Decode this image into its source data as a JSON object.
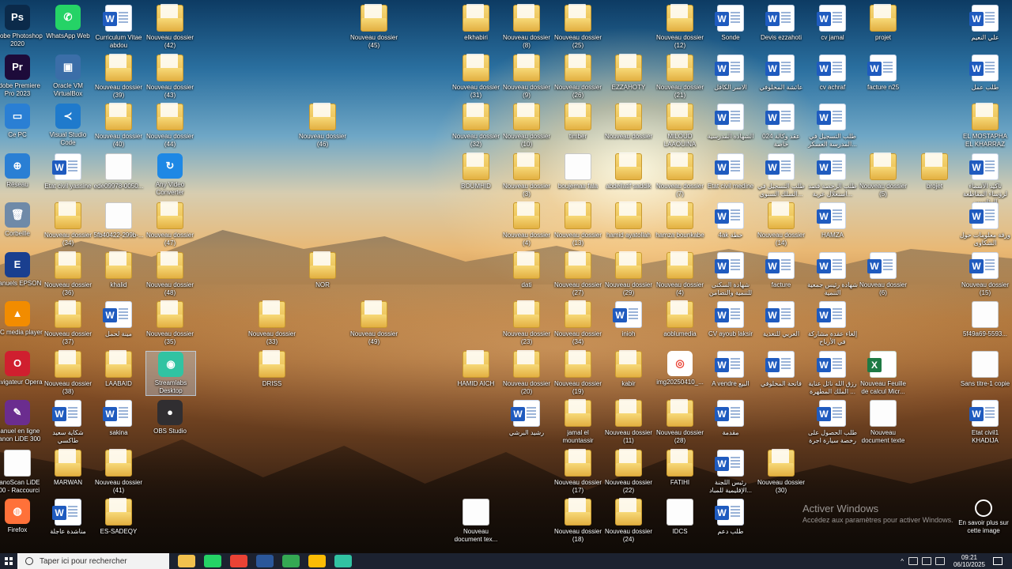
{
  "desktop": {
    "icons": [
      {
        "label": "Adobe Photoshop 2020",
        "type": "app",
        "abbr": "Ps",
        "color": "#0b2a4a"
      },
      {
        "label": "WhatsApp Web",
        "type": "app",
        "abbr": "✆",
        "color": "#25d366"
      },
      {
        "label": "Curriculum Vitae abdou",
        "type": "word"
      },
      {
        "label": "Nouveau dossier (42)",
        "type": "folder"
      },
      {
        "label": "Nouveau dossier (45)",
        "type": "folder"
      },
      {
        "label": "elkhabiri",
        "type": "folder"
      },
      {
        "label": "Nouveau dossier (8)",
        "type": "folder"
      },
      {
        "label": "Nouveau dossier (25)",
        "type": "folder"
      },
      {
        "label": "Nouveau dossier (12)",
        "type": "folder"
      },
      {
        "label": "Sonde",
        "type": "word"
      },
      {
        "label": "Devis ezzahoti",
        "type": "word"
      },
      {
        "label": "cv jamal",
        "type": "word"
      },
      {
        "label": "projet",
        "type": "folder"
      },
      {
        "label": "علي النعيم",
        "type": "word"
      },
      {
        "label": "Adobe Premiere Pro 2023",
        "type": "app",
        "abbr": "Pr",
        "color": "#1d0b3a"
      },
      {
        "label": "Oracle VM VirtualBox",
        "type": "app",
        "abbr": "▣",
        "color": "#3b6ea8"
      },
      {
        "label": "Nouveau dossier (39)",
        "type": "folder"
      },
      {
        "label": "Nouveau dossier (43)",
        "type": "folder"
      },
      {
        "label": "Nouveau dossier (31)",
        "type": "folder"
      },
      {
        "label": "Nouveau dossier (9)",
        "type": "folder"
      },
      {
        "label": "Nouveau dossier (26)",
        "type": "folder"
      },
      {
        "label": "EZZAHOTY",
        "type": "folder"
      },
      {
        "label": "Nouveau dossier (21)",
        "type": "folder"
      },
      {
        "label": "الاسر الكافل",
        "type": "word"
      },
      {
        "label": "عائشة المخلوفي",
        "type": "word"
      },
      {
        "label": "cv achraf",
        "type": "word"
      },
      {
        "label": "facture n25",
        "type": "word"
      },
      {
        "label": "طلب عمل",
        "type": "word"
      },
      {
        "label": "Ce PC",
        "type": "app",
        "abbr": "▭",
        "color": "#2a7fd4"
      },
      {
        "label": "Visual Studio Code",
        "type": "app",
        "abbr": "≺",
        "color": "#1f7acc"
      },
      {
        "label": "Nouveau dossier (40)",
        "type": "folder"
      },
      {
        "label": "Nouveau dossier (44)",
        "type": "folder"
      },
      {
        "label": "Nouveau dossier (46)",
        "type": "folder"
      },
      {
        "label": "Nouveau dossier (32)",
        "type": "folder"
      },
      {
        "label": "Nouveau dossier (10)",
        "type": "folder"
      },
      {
        "label": "timber",
        "type": "folder"
      },
      {
        "label": "Nouveau dossier",
        "type": "folder"
      },
      {
        "label": "MILOUD LAAOUINA",
        "type": "folder"
      },
      {
        "label": "الشهادة المدرسية",
        "type": "word"
      },
      {
        "label": "024 عقد وكالة خاصة",
        "type": "word"
      },
      {
        "label": "طلب التسجيل في المدرسة العسكر...",
        "type": "word"
      },
      {
        "label": "EL MOSTAPHA EL KHARRAZ",
        "type": "folder"
      },
      {
        "label": "Réseau",
        "type": "app",
        "abbr": "⊕",
        "color": "#2a7fd4"
      },
      {
        "label": "Etat civil yassine",
        "type": "word"
      },
      {
        "label": "ede09978-0050...",
        "type": "doc"
      },
      {
        "label": "Any Video Converter",
        "type": "app",
        "abbr": "↻",
        "color": "#1e88e5"
      },
      {
        "label": "BOUMHID",
        "type": "folder"
      },
      {
        "label": "Nouveau dossier (3)",
        "type": "folder"
      },
      {
        "label": "boujemaa fala",
        "type": "doc"
      },
      {
        "label": "abdellatif saddik",
        "type": "folder"
      },
      {
        "label": "Nouveau dossier (7)",
        "type": "folder"
      },
      {
        "label": "Etat civil medine",
        "type": "word"
      },
      {
        "label": "طلب التسجيل في السلك السنوي...",
        "type": "word"
      },
      {
        "label": "طلب الرخصة قصد استغلال عربة...",
        "type": "word"
      },
      {
        "label": "Nouveau dossier (5)",
        "type": "folder"
      },
      {
        "label": "brojet",
        "type": "folder"
      },
      {
        "label": "تأكيد الأسماء لرؤساء المقاطعة الرئاسيين",
        "type": "word"
      },
      {
        "label": "Corbeille",
        "type": "app",
        "abbr": "🗑",
        "color": "#6f8aa8"
      },
      {
        "label": "Nouveau dossier (34)",
        "type": "folder"
      },
      {
        "label": "5fb40422-299b-...",
        "type": "doc"
      },
      {
        "label": "Nouveau dossier (47)",
        "type": "folder"
      },
      {
        "label": "Nouveau dossier (4)",
        "type": "folder"
      },
      {
        "label": "Nouveau dossier (13)",
        "type": "folder"
      },
      {
        "label": "hamid ayatollah",
        "type": "folder"
      },
      {
        "label": "hamza bounkabe",
        "type": "folder"
      },
      {
        "label": "4ak خطة",
        "type": "word"
      },
      {
        "label": "Nouveau dossier (14)",
        "type": "folder"
      },
      {
        "label": "HAMZA",
        "type": "word"
      },
      {
        "label": "ورقة معلومات حول الشكاوى",
        "type": "word"
      },
      {
        "label": "Manuels EPSON",
        "type": "app",
        "abbr": "E",
        "color": "#1a3f8f"
      },
      {
        "label": "Nouveau dossier (36)",
        "type": "folder"
      },
      {
        "label": "khalid",
        "type": "folder"
      },
      {
        "label": "Nouveau dossier (48)",
        "type": "folder"
      },
      {
        "label": "NOR",
        "type": "folder"
      },
      {
        "label": "dati",
        "type": "folder"
      },
      {
        "label": "Nouveau dossier (27)",
        "type": "folder"
      },
      {
        "label": "Nouveau dossier (29)",
        "type": "folder"
      },
      {
        "label": "Nouveau dossier (4)",
        "type": "folder"
      },
      {
        "label": "شهادة السكنى للتنمية والتضامن",
        "type": "word"
      },
      {
        "label": "facture",
        "type": "word"
      },
      {
        "label": "شهادة رئيس جمعية التنمية",
        "type": "word"
      },
      {
        "label": "Nouveau dossier (6)",
        "type": "word"
      },
      {
        "label": "Nouveau dossier (15)",
        "type": "word"
      },
      {
        "label": "VLC media player",
        "type": "app",
        "abbr": "▲",
        "color": "#f28c00"
      },
      {
        "label": "Nouveau dossier (37)",
        "type": "folder"
      },
      {
        "label": "مينة لحمل",
        "type": "word"
      },
      {
        "label": "Nouveau dossier (35)",
        "type": "folder"
      },
      {
        "label": "Nouveau dossier (33)",
        "type": "folder"
      },
      {
        "label": "Nouveau dossier (49)",
        "type": "folder"
      },
      {
        "label": "Nouveau dossier (23)",
        "type": "folder"
      },
      {
        "label": "Nouveau dossier (34)",
        "type": "folder"
      },
      {
        "label": "inioh",
        "type": "word"
      },
      {
        "label": "aoblumedia",
        "type": "folder"
      },
      {
        "label": "CV ayoub laksir",
        "type": "word"
      },
      {
        "label": "العربي للتغذية",
        "type": "word"
      },
      {
        "label": "إلغاء عقدة مشاركة في الأرباح",
        "type": "word"
      },
      {
        "label": "5f49a69-5593...",
        "type": "doc"
      },
      {
        "label": "Navigateur Opera",
        "type": "app",
        "abbr": "O",
        "color": "#d01f2f"
      },
      {
        "label": "Nouveau dossier (38)",
        "type": "folder"
      },
      {
        "label": "LAABAID",
        "type": "folder"
      },
      {
        "label": "Streamlabs Desktop",
        "type": "app",
        "abbr": "◉",
        "color": "#31c3a2"
      },
      {
        "label": "DRISS",
        "type": "folder"
      },
      {
        "label": "HAMID AICH",
        "type": "folder"
      },
      {
        "label": "Nouveau dossier (20)",
        "type": "folder"
      },
      {
        "label": "Nouveau dossier (19)",
        "type": "folder"
      },
      {
        "label": "kabir",
        "type": "folder"
      },
      {
        "label": "img20250410_...",
        "type": "app",
        "abbr": "◎",
        "color": "#ffffff"
      },
      {
        "label": "A vendre البيع",
        "type": "word"
      },
      {
        "label": "فاتحة المخلوفي",
        "type": "word"
      },
      {
        "label": "رزق الله نائل عناية ... الملك المطهرة",
        "type": "word"
      },
      {
        "label": "Nouveau Feuille de calcul Micr...",
        "type": "excel"
      },
      {
        "label": "Sans titre-1 copie",
        "type": "doc"
      },
      {
        "label": "Manuel en ligne Canon LiDE 300",
        "type": "app",
        "abbr": "✎",
        "color": "#6b2d8f"
      },
      {
        "label": "شكاية سعيد طاكسي",
        "type": "word"
      },
      {
        "label": "sakina",
        "type": "word"
      },
      {
        "label": "OBS Studio",
        "type": "app",
        "abbr": "●",
        "color": "#302e31"
      },
      {
        "label": "رشيد البرشي",
        "type": "word"
      },
      {
        "label": "jamal el mountassir",
        "type": "folder"
      },
      {
        "label": "Nouveau dossier (11)",
        "type": "folder"
      },
      {
        "label": "Nouveau dossier (28)",
        "type": "folder"
      },
      {
        "label": "مقدمة",
        "type": "word"
      },
      {
        "label": "طلب الحصول على رخصة سيارة اجرة",
        "type": "word"
      },
      {
        "label": "Nouveau document texte",
        "type": "doc"
      },
      {
        "label": "Etat civil1 KHADIJA",
        "type": "word"
      },
      {
        "label": "CanoScan LiDE 300 - Raccourci",
        "type": "doc"
      },
      {
        "label": "MARWAN",
        "type": "folder"
      },
      {
        "label": "Nouveau dossier (41)",
        "type": "folder"
      },
      {
        "label": "Nouveau dossier (17)",
        "type": "folder"
      },
      {
        "label": "Nouveau dossier (22)",
        "type": "folder"
      },
      {
        "label": "FATIHI",
        "type": "folder"
      },
      {
        "label": "رئيس اللجنة الإقليمية للمباد...",
        "type": "word"
      },
      {
        "label": "Nouveau dossier (30)",
        "type": "folder"
      },
      {
        "label": "Firefox",
        "type": "app",
        "abbr": "◍",
        "color": "#ff7139"
      },
      {
        "label": "مناشدة عاجلة",
        "type": "word"
      },
      {
        "label": "ES-SADEQY",
        "type": "folder"
      },
      {
        "label": "Nouveau document tex...",
        "type": "doc"
      },
      {
        "label": "Nouveau dossier (18)",
        "type": "folder"
      },
      {
        "label": "Nouveau dossier (24)",
        "type": "folder"
      },
      {
        "label": "IDCS",
        "type": "doc"
      },
      {
        "label": "طلب دعم",
        "type": "word"
      }
    ]
  },
  "activation": {
    "title": "Activer Windows",
    "subtitle": "Accédez aux paramètres pour activer Windows."
  },
  "help": {
    "label": "En savoir plus sur cette image"
  },
  "taskbar": {
    "search_placeholder": "Taper ici pour rechercher",
    "apps": [
      {
        "name": "file-explorer",
        "color": "#f2c14e"
      },
      {
        "name": "whatsapp",
        "color": "#25d366"
      },
      {
        "name": "chrome",
        "color": "#ea4335"
      },
      {
        "name": "word",
        "color": "#2b579a"
      },
      {
        "name": "chrome-profile-2",
        "color": "#34a853"
      },
      {
        "name": "chrome-profile-3",
        "color": "#fbbc05"
      },
      {
        "name": "streamlabs",
        "color": "#31c3a2"
      }
    ],
    "tray": {
      "time": "09:21",
      "date": "06/10/2025"
    }
  }
}
